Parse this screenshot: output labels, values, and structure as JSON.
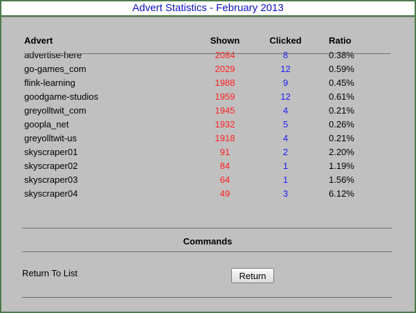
{
  "title": "Advert Statistics - February 2013",
  "table": {
    "headers": {
      "advert": "Advert",
      "shown": "Shown",
      "clicked": "Clicked",
      "ratio": "Ratio"
    },
    "rows": [
      {
        "advert": "advertise-here",
        "shown": "2084",
        "clicked": "8",
        "ratio": "0.38%"
      },
      {
        "advert": "go-games_com",
        "shown": "2029",
        "clicked": "12",
        "ratio": "0.59%"
      },
      {
        "advert": "flink-learning",
        "shown": "1988",
        "clicked": "9",
        "ratio": "0.45%"
      },
      {
        "advert": "goodgame-studios",
        "shown": "1959",
        "clicked": "12",
        "ratio": "0.61%"
      },
      {
        "advert": "greyolltwit_com",
        "shown": "1945",
        "clicked": "4",
        "ratio": "0.21%"
      },
      {
        "advert": "goopla_net",
        "shown": "1932",
        "clicked": "5",
        "ratio": "0.26%"
      },
      {
        "advert": "greyolltwit-us",
        "shown": "1918",
        "clicked": "4",
        "ratio": "0.21%"
      },
      {
        "advert": "skyscraper01",
        "shown": "91",
        "clicked": "2",
        "ratio": "2.20%"
      },
      {
        "advert": "skyscraper02",
        "shown": "84",
        "clicked": "1",
        "ratio": "1.19%"
      },
      {
        "advert": "skyscraper03",
        "shown": "64",
        "clicked": "1",
        "ratio": "1.56%"
      },
      {
        "advert": "skyscraper04",
        "shown": "49",
        "clicked": "3",
        "ratio": "6.12%"
      }
    ]
  },
  "commands": {
    "heading": "Commands",
    "return_label": "Return To List",
    "return_button": "Return"
  },
  "colors": {
    "title_text": "#1010c8",
    "shown_text": "#ff2020",
    "clicked_text": "#1a1af0",
    "panel_bg": "#c0c0c0",
    "frame_border": "#4c7a4c"
  }
}
